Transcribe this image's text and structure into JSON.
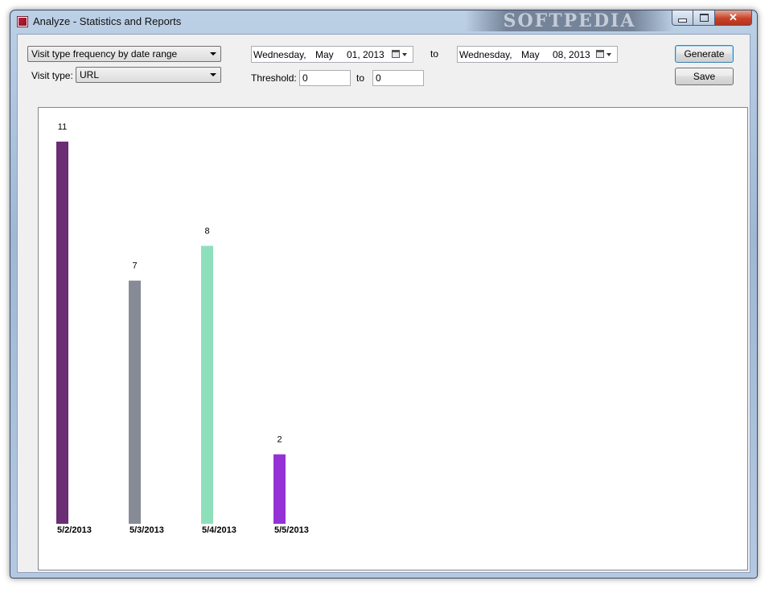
{
  "window": {
    "title": "Analyze - Statistics and Reports",
    "watermark": "SOFTPEDIA",
    "close_label": "✕"
  },
  "controls": {
    "report_type": "Visit type frequency by date range",
    "visit_type_label": "Visit type:",
    "visit_type_value": "URL",
    "date_from": {
      "day": "Wednesday,",
      "month": "May",
      "daynum_year": "01, 2013"
    },
    "to_label": "to",
    "date_to": {
      "day": "Wednesday,",
      "month": "May",
      "daynum_year": "08, 2013"
    },
    "threshold_label": "Threshold:",
    "threshold_from": "0",
    "threshold_to_label": "to",
    "threshold_to": "0",
    "generate_label": "Generate",
    "save_label": "Save"
  },
  "chart_data": {
    "type": "bar",
    "categories": [
      "5/2/2013",
      "5/3/2013",
      "5/4/2013",
      "5/5/2013"
    ],
    "values": [
      11,
      7,
      8,
      2
    ],
    "colors": [
      "#6b2d73",
      "#868b96",
      "#8ee0bc",
      "#9432d6"
    ],
    "title": "",
    "xlabel": "",
    "ylabel": "",
    "ylim": [
      0,
      11
    ],
    "grid": false,
    "legend": "none"
  }
}
